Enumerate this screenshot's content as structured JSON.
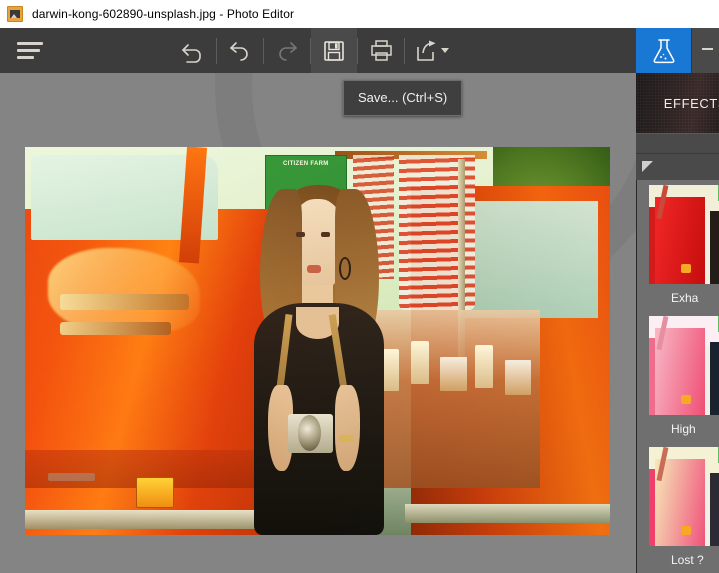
{
  "window": {
    "title": "darwin-kong-602890-unsplash.jpg - Photo Editor",
    "icon": "photo-file-icon"
  },
  "toolbar": {
    "menu_label": "Menu",
    "menu_icon": "hamburger-icon",
    "items": [
      {
        "name": "revert",
        "icon": "revert-arrow-icon",
        "enabled": true
      },
      {
        "name": "undo",
        "icon": "undo-arrow-icon",
        "enabled": true
      },
      {
        "name": "redo",
        "icon": "redo-arrow-icon",
        "enabled": false
      },
      {
        "name": "save",
        "icon": "floppy-disk-icon",
        "enabled": true,
        "active": true
      },
      {
        "name": "print",
        "icon": "printer-icon",
        "enabled": true
      },
      {
        "name": "share",
        "icon": "share-arrow-icon",
        "enabled": true,
        "has_dropdown": true
      }
    ]
  },
  "tooltip": {
    "visible": true,
    "text": "Save... (Ctrl+S)"
  },
  "canvas": {
    "photo_alt": "Woman holding a camera in front of an orange VW bus",
    "sign_text": "CITIZEN FARM"
  },
  "right_panel": {
    "tabs": [
      {
        "name": "effects",
        "icon": "flask-icon",
        "selected": true
      },
      {
        "name": "adjust",
        "icon": "sliders-icon",
        "selected": false
      }
    ],
    "header_title": "EFFECTS",
    "collapse_icon": "collapse-triangle-icon",
    "thumbnails": [
      {
        "label": "Exha",
        "variant": "v1"
      },
      {
        "label": "High",
        "variant": "v2"
      },
      {
        "label": "Lost ?",
        "variant": "v3"
      }
    ]
  },
  "colors": {
    "accent": "#1878d4",
    "titlebar_bg": "#ffffff",
    "toolbar_bg": "#3c3c3c",
    "canvas_bg": "#848484",
    "panel_bg": "#4d4d4d",
    "thumblist_bg": "#6f6f6f"
  }
}
